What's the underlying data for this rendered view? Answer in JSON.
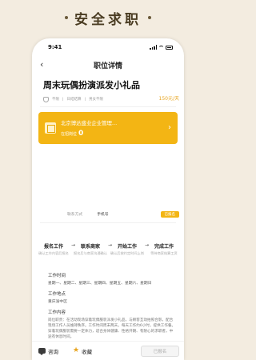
{
  "banner": {
    "title": "安全求职"
  },
  "status": {
    "time": "9:41"
  },
  "nav": {
    "title": "职位详情",
    "back_icon": "chevron-left-icon"
  },
  "job": {
    "title": "周末玩偶扮演派发小礼品",
    "meta": [
      "不限",
      "日结结算",
      "男女不限"
    ],
    "price": "150元/天"
  },
  "company": {
    "name": "北京博达盛业企业管理…",
    "count_label": "在招岗位",
    "count": "0"
  },
  "contact": {
    "label": "联系方式",
    "button": "手机号",
    "tag": "已报名"
  },
  "steps": [
    {
      "title": "报名工作",
      "desc": "确认工作内容后报名"
    },
    {
      "title": "联系商家",
      "desc": "报名后与商家沟通确认"
    },
    {
      "title": "开始工作",
      "desc": "确认后按约定时间上岗"
    },
    {
      "title": "完成工作",
      "desc": "等待商家结算工资"
    }
  ],
  "sections": {
    "time_label": "工作时间",
    "time_value": "星期一、星期二、星期三、星期四、星期五、星期六、星期日",
    "place_label": "工作地点",
    "place_value": "重庆渝中区",
    "content_label": "工作内容",
    "content_value": "岗位职责：在活动现场穿着玩偶服装派发小礼品，与顾客互动拍照合影，配合现场工作人员维持秩序。工作时间周末两天，每天工作约6小时，提供工作餐。穿着玩偶服装需要一定体力，适合身体健康、性格开朗、有耐心的求职者，中途有休息时间。"
  },
  "bottom": {
    "consult": "咨询",
    "favorite": "收藏",
    "signup": "已报名"
  }
}
